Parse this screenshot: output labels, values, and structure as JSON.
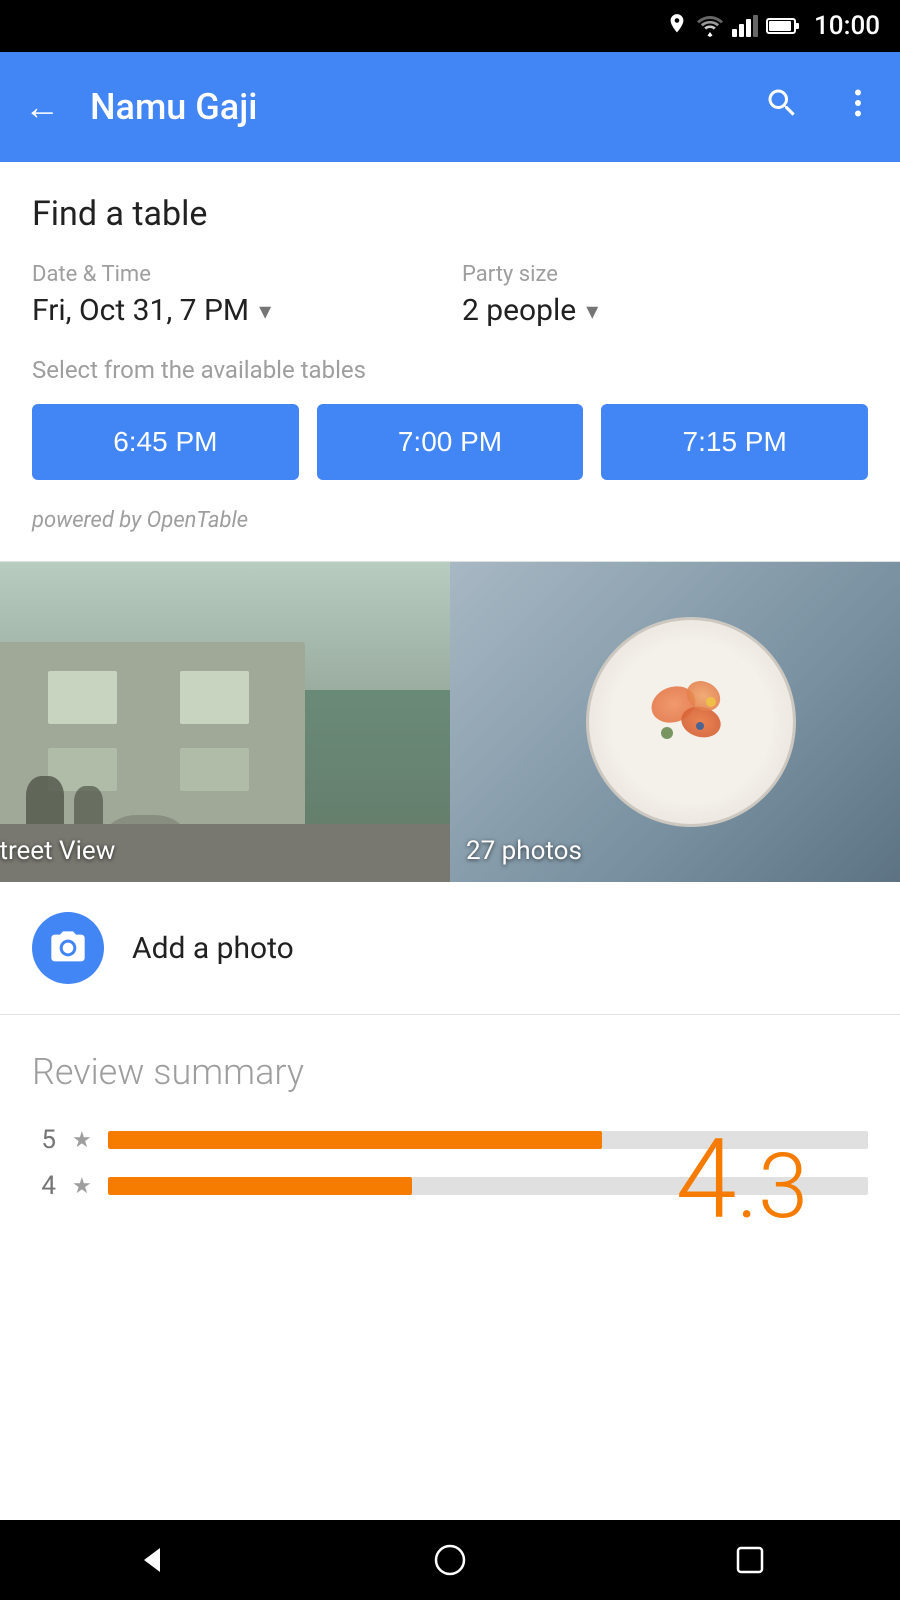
{
  "statusBar": {
    "time": "10:00",
    "icons": [
      "location",
      "wifi",
      "signal",
      "battery"
    ]
  },
  "toolbar": {
    "title": "Namu Gaji",
    "backLabel": "←",
    "searchLabel": "🔍",
    "moreLabel": "⋮"
  },
  "reservation": {
    "sectionTitle": "Find a table",
    "dateTimeLabel": "Date & Time",
    "dateTimeValue": "Fri, Oct 31, 7 PM",
    "partySizeLabel": "Party size",
    "partySizeValue": "2 people",
    "availableTablesLabel": "Select from the available tables",
    "timeSlots": [
      "6:45 PM",
      "7:00 PM",
      "7:15 PM"
    ],
    "poweredBy": "powered by OpenTable"
  },
  "photos": {
    "streetViewLabel": "Street View",
    "photosLabel": "27 photos"
  },
  "addPhoto": {
    "label": "Add a photo"
  },
  "reviewSummary": {
    "title": "Review summary",
    "bigRatingWhole": "4",
    "bigRatingDecimal": ".3",
    "bars": [
      {
        "star": "5",
        "widthPercent": 65
      },
      {
        "star": "4",
        "widthPercent": 40
      }
    ]
  },
  "navBar": {
    "back": "◁",
    "home": "○",
    "recents": "□"
  }
}
